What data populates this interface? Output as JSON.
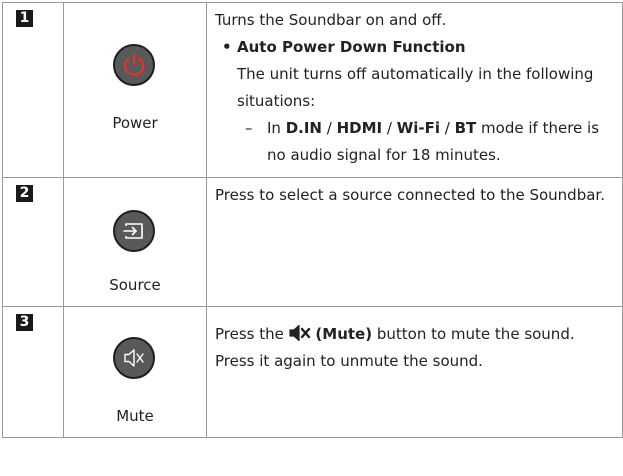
{
  "rows": [
    {
      "number": "1",
      "button": {
        "label": "Power",
        "icon": "power-icon",
        "icon_color": "#e8322b"
      },
      "description": {
        "line1": "Turns the Soundbar on and off.",
        "bullet_title": "Auto Power Down Function",
        "bullet_text": "The unit turns off automatically in the following situations:",
        "dash": "–",
        "sub_prefix": "In ",
        "modes": [
          "D.IN",
          "HDMI",
          "Wi-Fi",
          "BT"
        ],
        "mode_sep": " / ",
        "sub_suffix": " mode if there is no audio signal for 18 minutes."
      }
    },
    {
      "number": "2",
      "button": {
        "label": "Source",
        "icon": "source-icon"
      },
      "description": {
        "text": "Press to select a source connected to the Soundbar."
      }
    },
    {
      "number": "3",
      "button": {
        "label": "Mute",
        "icon": "mute-icon"
      },
      "description": {
        "pre": "Press the ",
        "bold": "(Mute)",
        "post": " button to mute the sound.",
        "line2": "Press it again to unmute the sound."
      }
    }
  ],
  "colors": {
    "button_fill": "#595959",
    "button_border": "#1f1f1f",
    "border": "#9a9a9a",
    "badge": "#1a1a1a"
  }
}
